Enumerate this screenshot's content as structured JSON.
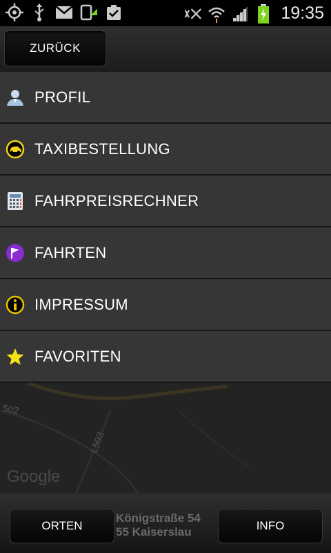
{
  "status": {
    "time": "19:35",
    "icons": [
      "gps-icon",
      "usb-icon",
      "gmail-icon",
      "sync-icon",
      "clipboard-check-icon",
      "no-sound-icon",
      "wifi-icon",
      "signal-icon",
      "battery-charging-icon"
    ]
  },
  "topbar": {
    "back_label": "ZURÜCK"
  },
  "menu": {
    "items": [
      {
        "label": "PROFIL",
        "icon": "user-icon"
      },
      {
        "label": "TAXIBESTELLUNG",
        "icon": "taxi-icon"
      },
      {
        "label": "FAHRPREISRECHNER",
        "icon": "calculator-icon"
      },
      {
        "label": "FAHRTEN",
        "icon": "flag-icon"
      },
      {
        "label": "IMPRESSUM",
        "icon": "info-icon"
      },
      {
        "label": "FAVORITEN",
        "icon": "star-icon"
      }
    ]
  },
  "map": {
    "road_labels": [
      "502",
      "L503"
    ],
    "attribution": "Google"
  },
  "bottom": {
    "left_label": "ORTEN",
    "right_label": "INFO",
    "address_line1": "Königstraße 54",
    "address_line2": "55 Kaiserslau"
  },
  "colors": {
    "accent_yellow": "#f2d21a",
    "flag_purple": "#8a2bd0",
    "info_yellow": "#e8c500"
  }
}
